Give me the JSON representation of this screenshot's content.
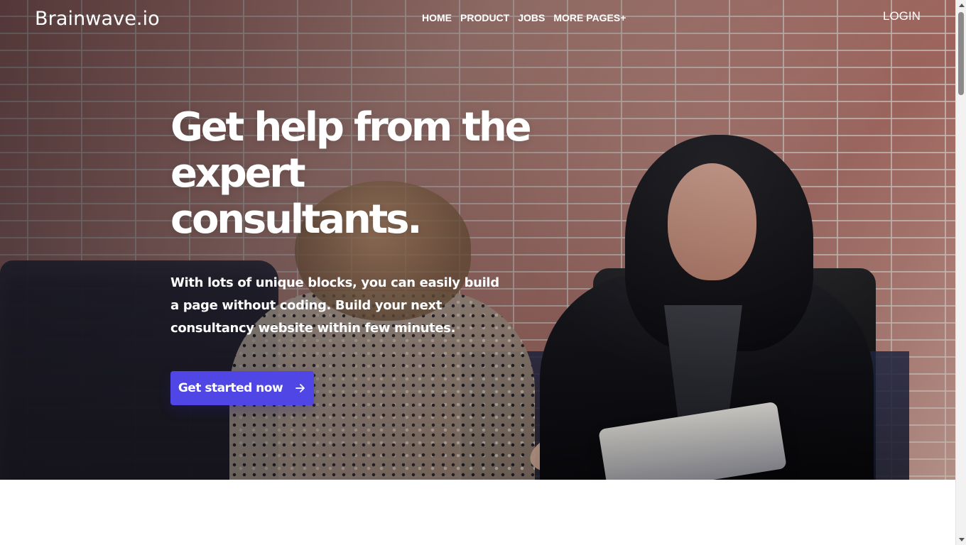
{
  "site": {
    "brand": "Brainwave.io"
  },
  "nav": {
    "items": [
      {
        "label": "HOME"
      },
      {
        "label": "PRODUCT"
      },
      {
        "label": "JOBS"
      },
      {
        "label": "MORE PAGES+"
      }
    ],
    "login": "LOGIN"
  },
  "hero": {
    "title": "Get help from the expert consultants.",
    "description": "With lots of unique blocks, you can easily build a page without coding. Build your next consultancy website within few minutes.",
    "cta_label": "Get started now",
    "cta_icon": "arrow-right-icon"
  },
  "colors": {
    "accent": "#4F46E5",
    "text_on_hero": "#FFFFFF",
    "page_background": "#FFFFFF"
  },
  "scrollbar": {
    "visible": true
  }
}
